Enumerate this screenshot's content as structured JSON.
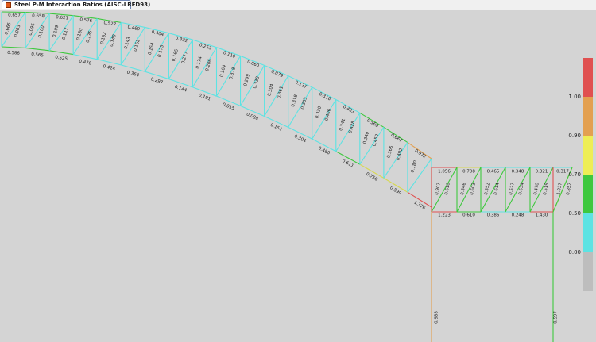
{
  "window": {
    "tab_title": "Steel P-M Interaction Ratios  (AISC-LRFD93)"
  },
  "legend": {
    "colors": [
      "#bdbdbd",
      "#5de3e3",
      "#3ec83e",
      "#eeee55",
      "#e3a050",
      "#e05050"
    ],
    "labels": [
      "0.00",
      "0.50",
      "0.70",
      "0.90",
      "1.00"
    ]
  },
  "member_colors": {
    "low": "#5de3e3",
    "mid": "#3ec83e",
    "warn": "#d8d850",
    "high": "#e3a050",
    "over": "#e05050"
  },
  "truss": {
    "top_chord": [
      "0.657",
      "0.658",
      "0.621",
      "0.576",
      "0.527",
      "0.469",
      "0.404",
      "0.332",
      "0.253",
      "0.110",
      "0.060",
      "0.079",
      "0.137",
      "0.316",
      "0.433",
      "0.560",
      "0.667",
      "0.972"
    ],
    "bottom_chord": [
      "0.586",
      "0.565",
      "0.525",
      "0.476",
      "0.424",
      "0.364",
      "0.297",
      "0.144",
      "0.101",
      "0.055",
      "0.088",
      "0.151",
      "0.304",
      "0.480",
      "0.611",
      "0.756",
      "0.899",
      "1.376"
    ],
    "diagonals": [
      "0.665",
      "0.083",
      "0.096",
      "0.100",
      "0.109",
      "0.117",
      "0.130",
      "0.135",
      "0.132",
      "0.148",
      "0.143",
      "0.162",
      "0.154",
      "0.175",
      "0.165",
      "0.277",
      "0.174",
      "0.206",
      "0.164",
      "0.318",
      "0.299",
      "0.338",
      "0.304",
      "0.361",
      "0.318",
      "0.383",
      "0.330",
      "0.406",
      "0.341",
      "0.428",
      "0.340",
      "0.450",
      "0.365",
      "0.492",
      "0.180"
    ]
  },
  "frame": {
    "top_chord": [
      "1.056",
      "0.708",
      "0.465",
      "0.348",
      "0.321",
      "0.317"
    ],
    "bottom_chord": [
      "1.223",
      "0.610",
      "0.386",
      "0.248",
      "1.430"
    ],
    "verticals": [
      "0.907",
      "0.610",
      "0.546",
      "0.603",
      "0.552",
      "0.614",
      "0.527",
      "0.634",
      "0.470",
      "0.519",
      "1.037",
      "0.852"
    ],
    "columns": [
      "0.988",
      "0.597"
    ]
  }
}
